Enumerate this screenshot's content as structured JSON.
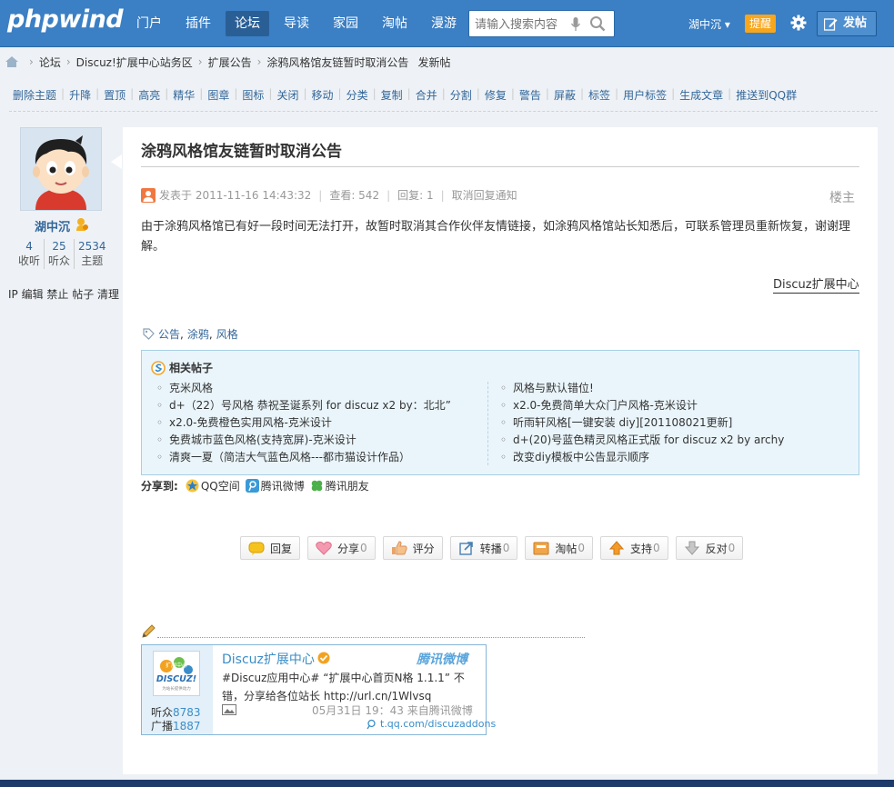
{
  "header": {
    "logo": "phpwind",
    "nav": [
      "门户",
      "插件",
      "论坛",
      "导读",
      "家园",
      "淘帖",
      "漫游"
    ],
    "active_nav": 2,
    "search_placeholder": "请输入搜索内容",
    "user": "湖中沉",
    "user_caret": "▾",
    "tip": "提醒",
    "post_button": "发帖"
  },
  "breadcrumb": [
    "论坛",
    "Discuz!扩展中心站务区",
    "扩展公告",
    "涂鸦风格馆友链暂时取消公告",
    "发新帖"
  ],
  "toolbar": [
    "删除主题",
    "升降",
    "置顶",
    "高亮",
    "精华",
    "图章",
    "图标",
    "关闭",
    "移动",
    "分类",
    "复制",
    "合并",
    "分割",
    "修复",
    "警告",
    "屏蔽",
    "标签",
    "用户标签",
    "生成文章",
    "推送到QQ群"
  ],
  "author": {
    "name": "湖中沉",
    "stats": [
      {
        "num": "4",
        "label": "收听"
      },
      {
        "num": "25",
        "label": "听众"
      },
      {
        "num": "2534",
        "label": "主题"
      }
    ],
    "admin_links": "IP 编辑 禁止 帖子 清理"
  },
  "post": {
    "title": "涂鸦风格馆友链暂时取消公告",
    "posted_at": "发表于 2011-11-16 14:43:32",
    "views": "查看: 542",
    "replies": "回复: 1",
    "cancel_notify": "取消回复通知",
    "floor": "楼主",
    "content": "由于涂鸦风格馆已有好一段时间无法打开，故暂时取消其合作伙伴友情链接，如涂鸦风格馆站长知悉后，可联系管理员重新恢复，谢谢理解。",
    "source": "Discuz扩展中心",
    "tags": [
      "公告",
      "涂鸦",
      "风格"
    ]
  },
  "related": {
    "title": "相关帖子",
    "left": [
      "克米风格",
      "d+（22）号风格 恭祝圣诞系列 for discuz x2 by：北北”",
      "x2.0-免费橙色实用风格-克米设计",
      "免费城市蓝色风格(支持宽屏)-克米设计",
      "清爽一夏（简洁大气蓝色风格---都市猫设计作品）"
    ],
    "right": [
      "风格与默认错位!",
      "x2.0-免费简单大众门户风格-克米设计",
      "听雨轩风格[一键安装 diy][201108021更新]",
      "d+(20)号蓝色精灵风格正式版 for discuz x2 by archy",
      "改变diy模板中公告显示顺序"
    ]
  },
  "share": {
    "label": "分享到:",
    "items": [
      "QQ空间",
      "腾讯微博",
      "腾讯朋友"
    ]
  },
  "actions": [
    {
      "label": "回复",
      "count": ""
    },
    {
      "label": "分享",
      "count": "0"
    },
    {
      "label": "评分",
      "count": ""
    },
    {
      "label": "转播",
      "count": "0"
    },
    {
      "label": "淘帖",
      "count": "0"
    },
    {
      "label": "支持",
      "count": "0"
    },
    {
      "label": "反对",
      "count": "0"
    }
  ],
  "weibo": {
    "name": "Discuz扩展中心",
    "brand": "腾讯微博",
    "logo_line1": "扩展中心",
    "logo_line2": "DISCUZ!",
    "logo_line3": "为站长提供动力",
    "fans_label": "听众",
    "fans": "8783",
    "broadcast_label": "广播",
    "broadcast": "1887",
    "text": "#Discuz应用中心# “扩展中心首页N格 1.1.1” 不错，分享给各位站长  http://url.cn/1Wlvsq",
    "time": "05月31日  19：43 来自腾讯微博",
    "url": "t.qq.com/discuzaddons"
  },
  "colors": {
    "header_bg": "#3b7fc4",
    "link": "#336699",
    "tip": "#f8a61c",
    "related_bg": "#eaf5fb"
  }
}
